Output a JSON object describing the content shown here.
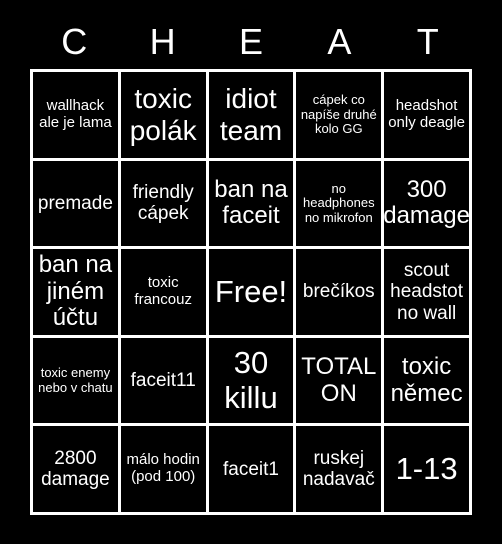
{
  "card": {
    "header_letters": [
      "C",
      "H",
      "E",
      "A",
      "T"
    ],
    "background_color": "#000000",
    "grid_line_color": "#ffffff",
    "text_color": "#ffffff",
    "rows": 5,
    "columns": 5,
    "cells": [
      {
        "text": "wallhack ale je lama",
        "size": "s"
      },
      {
        "text": "toxic polák",
        "size": "xl"
      },
      {
        "text": "idiot team",
        "size": "xl"
      },
      {
        "text": "cápek co napíše druhé kolo GG",
        "size": "xs"
      },
      {
        "text": "headshot only deagle",
        "size": "s"
      },
      {
        "text": "premade",
        "size": "m"
      },
      {
        "text": "friendly cápek",
        "size": "m"
      },
      {
        "text": "ban na faceit",
        "size": "l"
      },
      {
        "text": "no headphones no mikrofon",
        "size": "xs"
      },
      {
        "text": "300 damage",
        "size": "l"
      },
      {
        "text": "ban na jiném účtu",
        "size": "l"
      },
      {
        "text": "toxic francouz",
        "size": "s"
      },
      {
        "text": "Free!",
        "size": "xxl"
      },
      {
        "text": "brečíkos",
        "size": "m"
      },
      {
        "text": "scout headstot no wall",
        "size": "m"
      },
      {
        "text": "toxic enemy nebo v chatu",
        "size": "xs"
      },
      {
        "text": "faceit11",
        "size": "m"
      },
      {
        "text": "30 killu",
        "size": "xxl"
      },
      {
        "text": "TOTAL ON",
        "size": "l"
      },
      {
        "text": "toxic němec",
        "size": "l"
      },
      {
        "text": "2800 damage",
        "size": "m"
      },
      {
        "text": "málo hodin (pod 100)",
        "size": "s"
      },
      {
        "text": "faceit1",
        "size": "m"
      },
      {
        "text": "ruskej nadavač",
        "size": "m"
      },
      {
        "text": "1-13",
        "size": "xxl"
      }
    ]
  }
}
